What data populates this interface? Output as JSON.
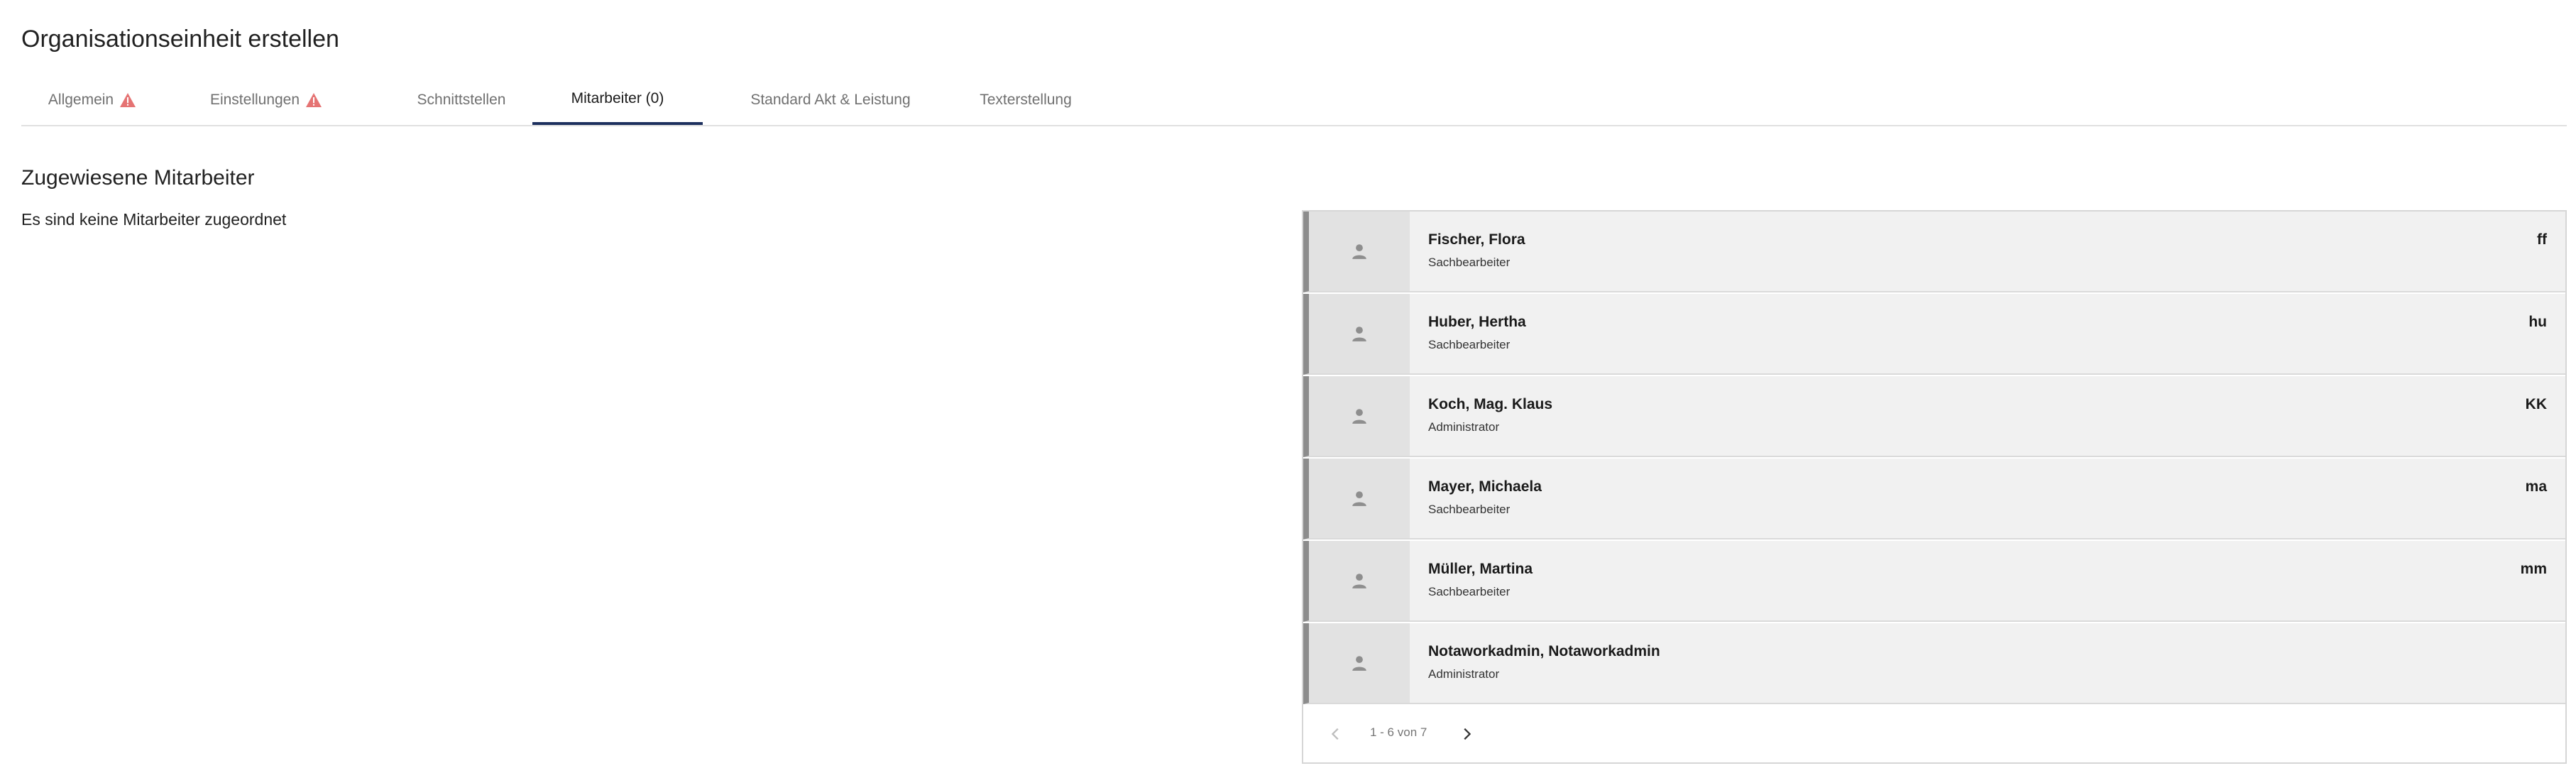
{
  "page": {
    "title": "Organisationseinheit erstellen"
  },
  "tabs": [
    {
      "label": "Allgemein",
      "warning": true
    },
    {
      "label": "Einstellungen",
      "warning": true
    },
    {
      "label": "Schnittstellen",
      "warning": false
    },
    {
      "label": "Mitarbeiter (0)",
      "warning": false,
      "active": true
    },
    {
      "label": "Standard Akt & Leistung",
      "warning": false
    },
    {
      "label": "Texterstellung",
      "warning": false
    }
  ],
  "assigned": {
    "title": "Zugewiesene Mitarbeiter",
    "empty_text": "Es sind keine Mitarbeiter zugeordnet"
  },
  "employees": [
    {
      "name": "Fischer, Flora",
      "role": "Sachbearbeiter",
      "initials": "ff",
      "icon": "person-icon"
    },
    {
      "name": "Huber, Hertha",
      "role": "Sachbearbeiter",
      "initials": "hu",
      "icon": "person-icon"
    },
    {
      "name": "Koch, Mag. Klaus",
      "role": "Administrator",
      "initials": "KK",
      "icon": "person-icon"
    },
    {
      "name": "Mayer, Michaela",
      "role": "Sachbearbeiter",
      "initials": "ma",
      "icon": "person-icon"
    },
    {
      "name": "Müller, Martina",
      "role": "Sachbearbeiter",
      "initials": "mm",
      "icon": "person-icon"
    },
    {
      "name": "Notaworkadmin, Notaworkadmin",
      "role": "Administrator",
      "initials": "",
      "icon": "person-icon"
    }
  ],
  "pagination": {
    "range_text": "1 - 6 von 7",
    "prev_icon": "chevron-left-icon",
    "next_icon": "chevron-right-icon"
  },
  "colors": {
    "active_tab_underline": "#1c2f5e",
    "warning": "#e57373",
    "item_bar": "#8c8c8c"
  }
}
